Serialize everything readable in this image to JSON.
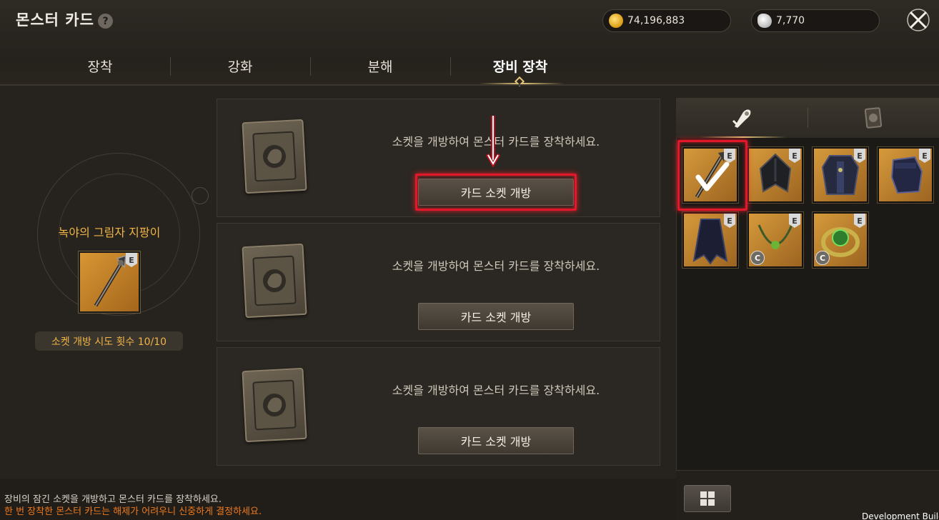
{
  "header": {
    "title": "몬스터 카드",
    "help_label": "?",
    "gold": "74,196,883",
    "gem": "7,770",
    "close_icon": "close-x-icon"
  },
  "tabs": [
    {
      "label": "장착",
      "active": false
    },
    {
      "label": "강화",
      "active": false
    },
    {
      "label": "분해",
      "active": false
    },
    {
      "label": "장비 장착",
      "active": true
    }
  ],
  "left_panel": {
    "weapon_name": "녹야의 그림자 지팡이",
    "weapon_badge": "E",
    "attempts_label": "소켓 개방 시도 횟수 10/10"
  },
  "sockets": [
    {
      "message": "소켓을 개방하여 몬스터 카드를 장착하세요.",
      "button": "카드 소켓 개방",
      "highlighted": true
    },
    {
      "message": "소켓을 개방하여 몬스터 카드를 장착하세요.",
      "button": "카드 소켓 개방",
      "highlighted": false
    },
    {
      "message": "소켓을 개방하여 몬스터 카드를 장착하세요.",
      "button": "카드 소켓 개방",
      "highlighted": false
    }
  ],
  "notes": {
    "line1": "장비의 잠긴 소켓을 개방하고 몬스터 카드를 장착하세요.",
    "line2": "한 번 장착한 몬스터 카드는 해제가 어려우니 신중하게 결정하세요."
  },
  "inventory": {
    "tabs": [
      {
        "icon": "equipment-icon",
        "active": true
      },
      {
        "icon": "monster-card-icon",
        "active": false
      }
    ],
    "items": [
      {
        "icon": "staff-icon",
        "badge": "E",
        "selected": true,
        "grade": ""
      },
      {
        "icon": "helmet-icon",
        "badge": "E",
        "selected": false,
        "grade": ""
      },
      {
        "icon": "armor-icon",
        "badge": "E",
        "selected": false,
        "grade": ""
      },
      {
        "icon": "gauntlet-icon",
        "badge": "E",
        "selected": false,
        "grade": ""
      },
      {
        "icon": "cloak-icon",
        "badge": "E",
        "selected": false,
        "grade": ""
      },
      {
        "icon": "necklace-icon",
        "badge": "E",
        "selected": false,
        "grade": "C"
      },
      {
        "icon": "ring-icon",
        "badge": "E",
        "selected": false,
        "grade": "C"
      }
    ],
    "grid_button_icon": "grid-view-icon"
  },
  "footer": {
    "dev_label": "Development Build"
  },
  "colors": {
    "highlight": "#e0182a",
    "accent_gold": "#f0b447",
    "warning": "#f07a1a"
  }
}
